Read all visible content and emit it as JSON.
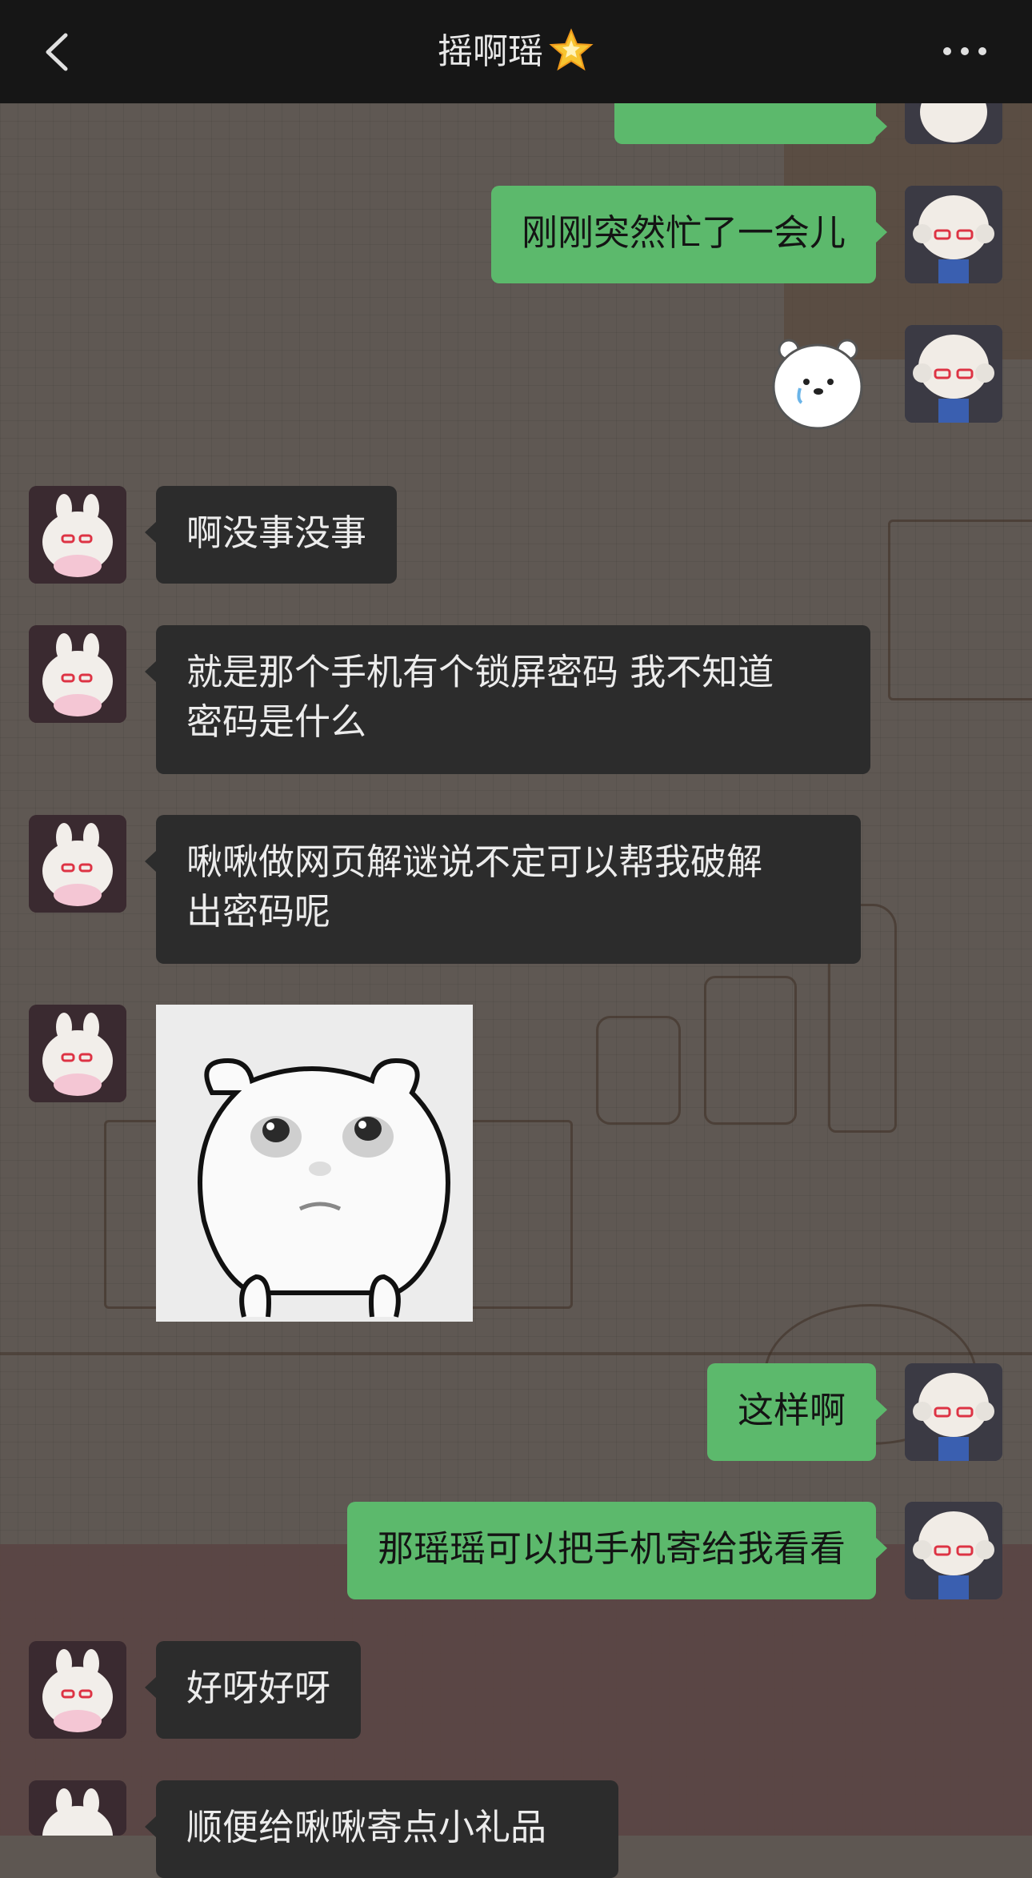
{
  "header": {
    "title": "摇啊瑶",
    "back_icon": "chevron-left-icon",
    "title_icon": "glowing-star-icon",
    "more_icon": "more-dots-icon",
    "background": "#161616"
  },
  "colors": {
    "sent_bubble": "#5cb96c",
    "received_bubble": "#2c2c2c"
  },
  "messages": [
    {
      "from": "me",
      "type": "text",
      "text": "刚刚突然忙了一会儿"
    },
    {
      "from": "me",
      "type": "sticker",
      "icon": "white-bear-sticker-icon"
    },
    {
      "from": "them",
      "type": "text",
      "text": "啊没事没事"
    },
    {
      "from": "them",
      "type": "text",
      "text": "就是那个手机有个锁屏密码 我不知道\n密码是什么"
    },
    {
      "from": "them",
      "type": "text",
      "text": "啾啾做网页解谜说不定可以帮我破解\n出密码呢"
    },
    {
      "from": "them",
      "type": "image",
      "icon": "bear-face-meme-image"
    },
    {
      "from": "me",
      "type": "text",
      "text": "这样啊"
    },
    {
      "from": "me",
      "type": "text",
      "text": "那瑶瑶可以把手机寄给我看看"
    },
    {
      "from": "them",
      "type": "text",
      "text": "好呀好呀"
    },
    {
      "from": "them",
      "type": "text",
      "text": "顺便给啾啾寄点小礼品"
    }
  ]
}
